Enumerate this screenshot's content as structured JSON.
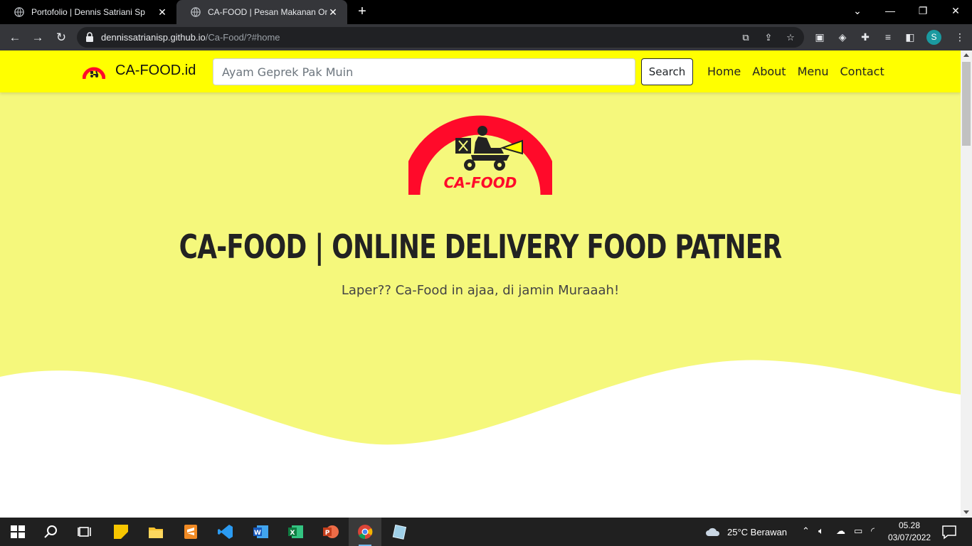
{
  "browser": {
    "tabs": [
      {
        "title": "Portofolio | Dennis Satriani Sp",
        "active": false
      },
      {
        "title": "CA-FOOD | Pesan Makanan Online",
        "active": true
      }
    ],
    "new_tab_label": "+",
    "url_domain": "dennissatrianisp.github.io",
    "url_path": "/Ca-Food/?#home",
    "profile_initial": "S"
  },
  "site": {
    "brand_name": "CA-FOOD.id",
    "search": {
      "placeholder": "Ayam Geprek Pak Muin",
      "value": "",
      "button_label": "Search"
    },
    "nav": [
      {
        "label": "Home"
      },
      {
        "label": "About"
      },
      {
        "label": "Menu"
      },
      {
        "label": "Contact"
      }
    ],
    "hero": {
      "logo_text": "CA-FOOD",
      "title": "CA-FOOD | ONLINE DELIVERY FOOD PATNER",
      "subtitle": "Laper?? Ca-Food in ajaa, di jamin Muraaah!"
    },
    "colors": {
      "nav_bg": "#ffff00",
      "hero_bg": "#f5f87c",
      "logo_red": "#ff0a2a"
    }
  },
  "taskbar": {
    "weather": "25°C  Berawan",
    "time": "05.28",
    "date": "03/07/2022",
    "apps": [
      "start-icon",
      "search-icon",
      "task-view-icon",
      "sticky-notes-icon",
      "file-explorer-icon",
      "sublime-text-icon",
      "vscode-icon",
      "word-icon",
      "excel-icon",
      "powerpoint-icon",
      "chrome-icon",
      "notepad-icon"
    ]
  }
}
